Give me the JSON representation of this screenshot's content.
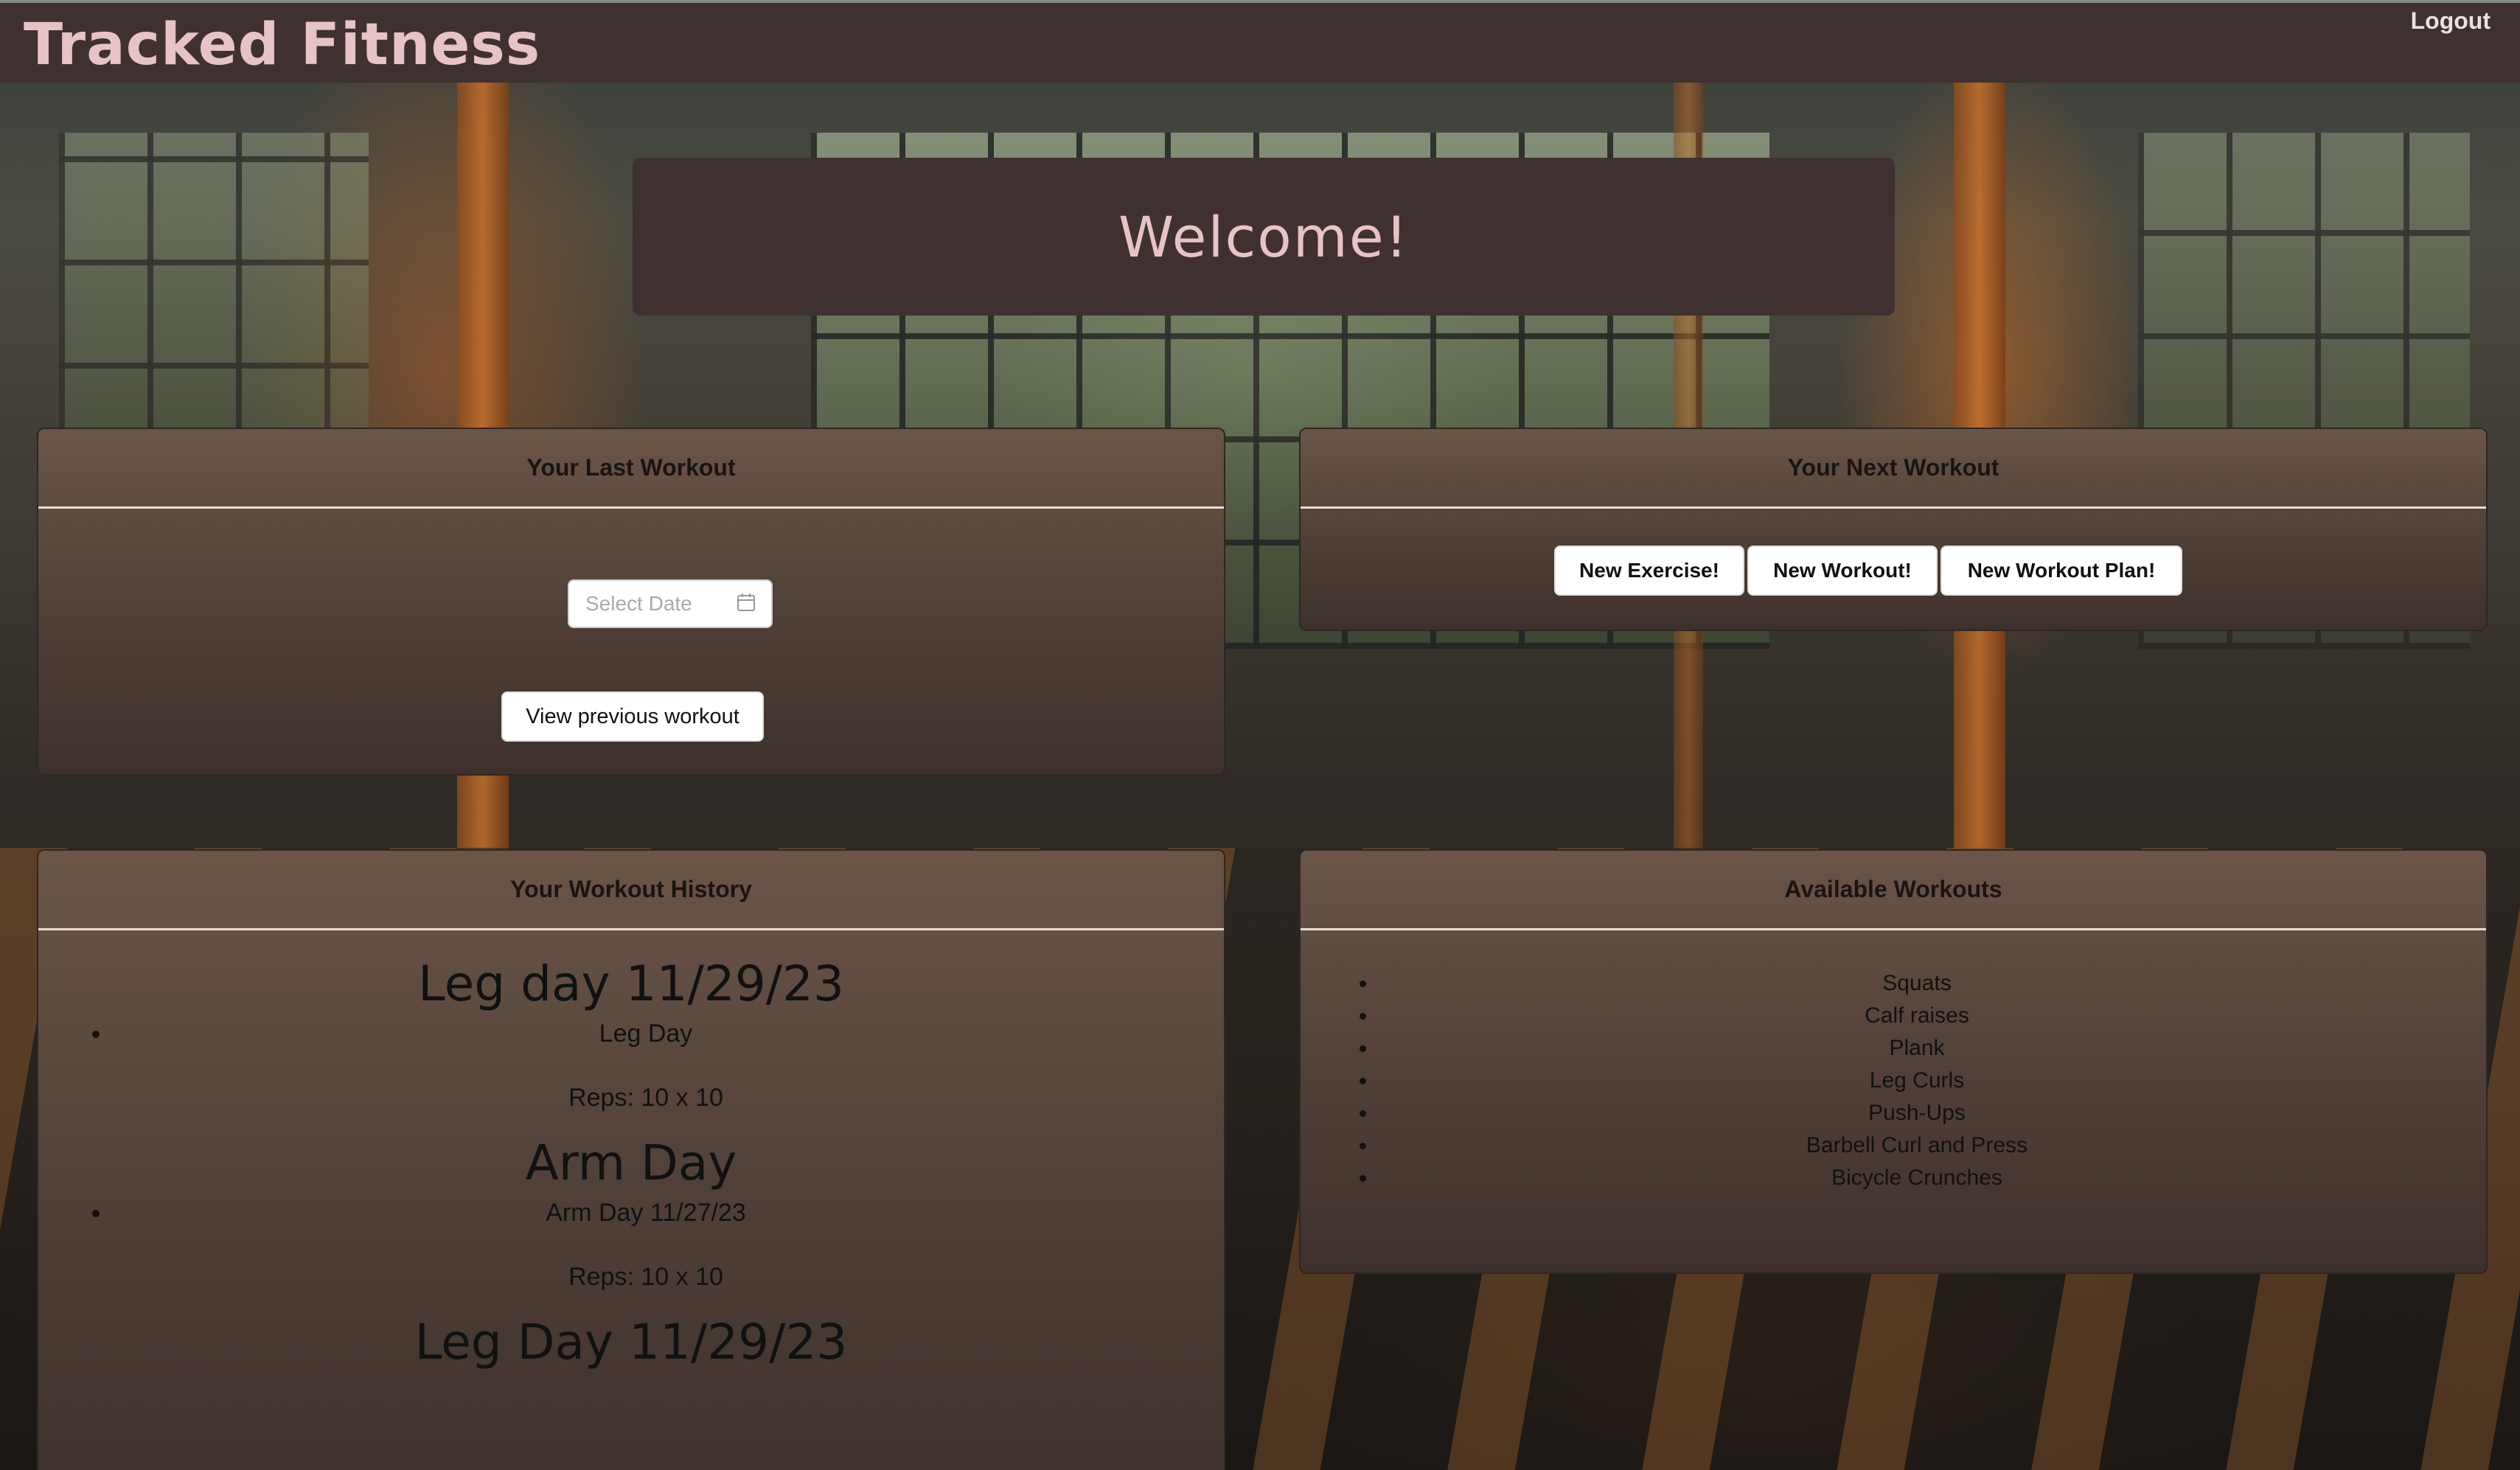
{
  "app": {
    "brand": "Tracked Fitness",
    "logout_label": "Logout"
  },
  "welcome": {
    "title": "Welcome!"
  },
  "last_workout": {
    "title": "Your Last Workout",
    "date_placeholder": "Select Date",
    "view_button_label": "View previous workout"
  },
  "next_workout": {
    "title": "Your Next Workout",
    "buttons": [
      {
        "label": "New Exercise!"
      },
      {
        "label": "New Workout!"
      },
      {
        "label": "New Workout Plan!"
      }
    ]
  },
  "history": {
    "title": "Your Workout History",
    "entries": [
      {
        "heading": "Leg day 11/29/23",
        "item": "Leg Day",
        "reps": "Reps: 10 x 10"
      },
      {
        "heading": "Arm Day",
        "item": "Arm Day 11/27/23",
        "reps": "Reps: 10 x 10"
      },
      {
        "heading": "Leg Day 11/29/23"
      }
    ]
  },
  "available": {
    "title": "Available Workouts",
    "items": [
      "Squats",
      "Calf raises",
      "Plank",
      "Leg Curls",
      "Push-Ups",
      "Barbell Curl and Press",
      "Bicycle Crunches"
    ]
  }
}
